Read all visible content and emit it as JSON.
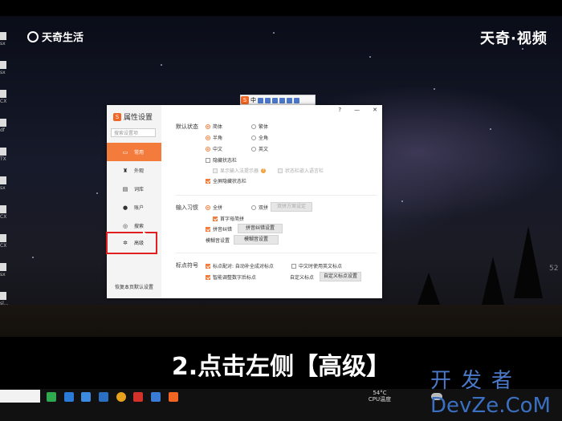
{
  "brand": {
    "left_logo": "天奇生活",
    "right_logo": "天奇·视频",
    "watermark_top": "开发者",
    "watermark_bottom": "DevZe.CoM"
  },
  "caption": "2.点击左侧【高级】",
  "side_number": "52",
  "desktop_files": [
    {
      "ext": "sx"
    },
    {
      "ext": "sx"
    },
    {
      "ext": "CX"
    },
    {
      "ext": "df"
    },
    {
      "ext": "TX"
    },
    {
      "ext": "sl..."
    },
    {
      "ext": "sx"
    },
    {
      "ext": "CX"
    },
    {
      "ext": "CX"
    },
    {
      "ext": "sx"
    }
  ],
  "ime_toolbar": {
    "logo": "S",
    "mode": "中"
  },
  "dialog": {
    "app_logo": "S",
    "title": "属性设置",
    "search_placeholder": "搜索设置项",
    "title_buttons": [
      "?",
      "—",
      "✕"
    ],
    "sidebar": [
      {
        "label": "常用",
        "icon": "monitor-icon",
        "active": true
      },
      {
        "label": "外观",
        "icon": "shirt-icon",
        "active": false
      },
      {
        "label": "词库",
        "icon": "book-icon",
        "active": false
      },
      {
        "label": "账户",
        "icon": "user-icon",
        "active": false
      },
      {
        "label": "搜索",
        "icon": "search-icon",
        "active": false
      },
      {
        "label": "高级",
        "icon": "gear-icon",
        "active": false
      }
    ],
    "restore_button": "恢复本页默认设置",
    "default_state": {
      "label": "默认状态",
      "simplified": "简体",
      "traditional": "繁体",
      "half_width": "半角",
      "full_width": "全角",
      "chinese": "中文",
      "english": "英文",
      "hide_status_bar": "隐藏状态栏",
      "show_ime_tip": "显示输入法提示器",
      "status_bar_embed": "状态栏嵌入语言栏",
      "fullscreen_hide": "全屏隐藏状态栏"
    },
    "input_habit": {
      "label": "输入习惯",
      "full_pinyin": "全拼",
      "double_pinyin": "双拼",
      "double_scheme_btn": "双拼方案设定",
      "initial_jianpin": "首字母简拼",
      "pinyin_correction": "拼音纠错",
      "pinyin_correction_btn": "拼音纠错设置",
      "fuzzy_setting": "模糊音设置",
      "fuzzy_btn": "模糊音设置"
    },
    "punctuation": {
      "label": "标点符号",
      "auto_pair": "标点配对: 自动补全成对标点",
      "english_punct": "中文时使用英文标点",
      "smart_adjust": "智能调整数字后标点",
      "custom_punct_label": "自定义标点",
      "custom_punct_btn": "自定义标点设置"
    }
  },
  "taskbar": {
    "temp": "54°C",
    "cpu_label": "CPU温度"
  }
}
